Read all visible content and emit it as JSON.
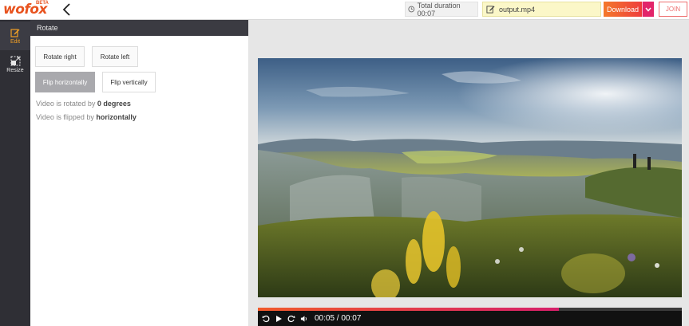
{
  "header": {
    "logo_text": "wofox",
    "logo_badge": "BETA",
    "duration_label": "Total duration 00:07",
    "filename": "output.mp4",
    "download_label": "Download",
    "join_label": "JOIN"
  },
  "rail": {
    "items": [
      {
        "label": "Edit",
        "icon": "edit-icon"
      },
      {
        "label": "Resize",
        "icon": "resize-icon"
      }
    ]
  },
  "panel": {
    "title": "Rotate",
    "buttons": {
      "rotate_right": "Rotate right",
      "rotate_left": "Rotate left",
      "flip_horizontally": "Flip horizontally",
      "flip_vertically": "Flip vertically"
    },
    "rotation_prefix": "Video is rotated by ",
    "rotation_value": "0 degrees",
    "flip_prefix": "Video is flipped by ",
    "flip_value": "horizontally"
  },
  "player": {
    "current_time": "00:05",
    "separator": " / ",
    "total_time": "00:07",
    "progress": 0.71
  },
  "colors": {
    "accent": "#f4a125",
    "brand": "#e8531f",
    "download_start": "#f4792b",
    "download_end": "#ee3d3d",
    "highlight": "#e2256a"
  }
}
